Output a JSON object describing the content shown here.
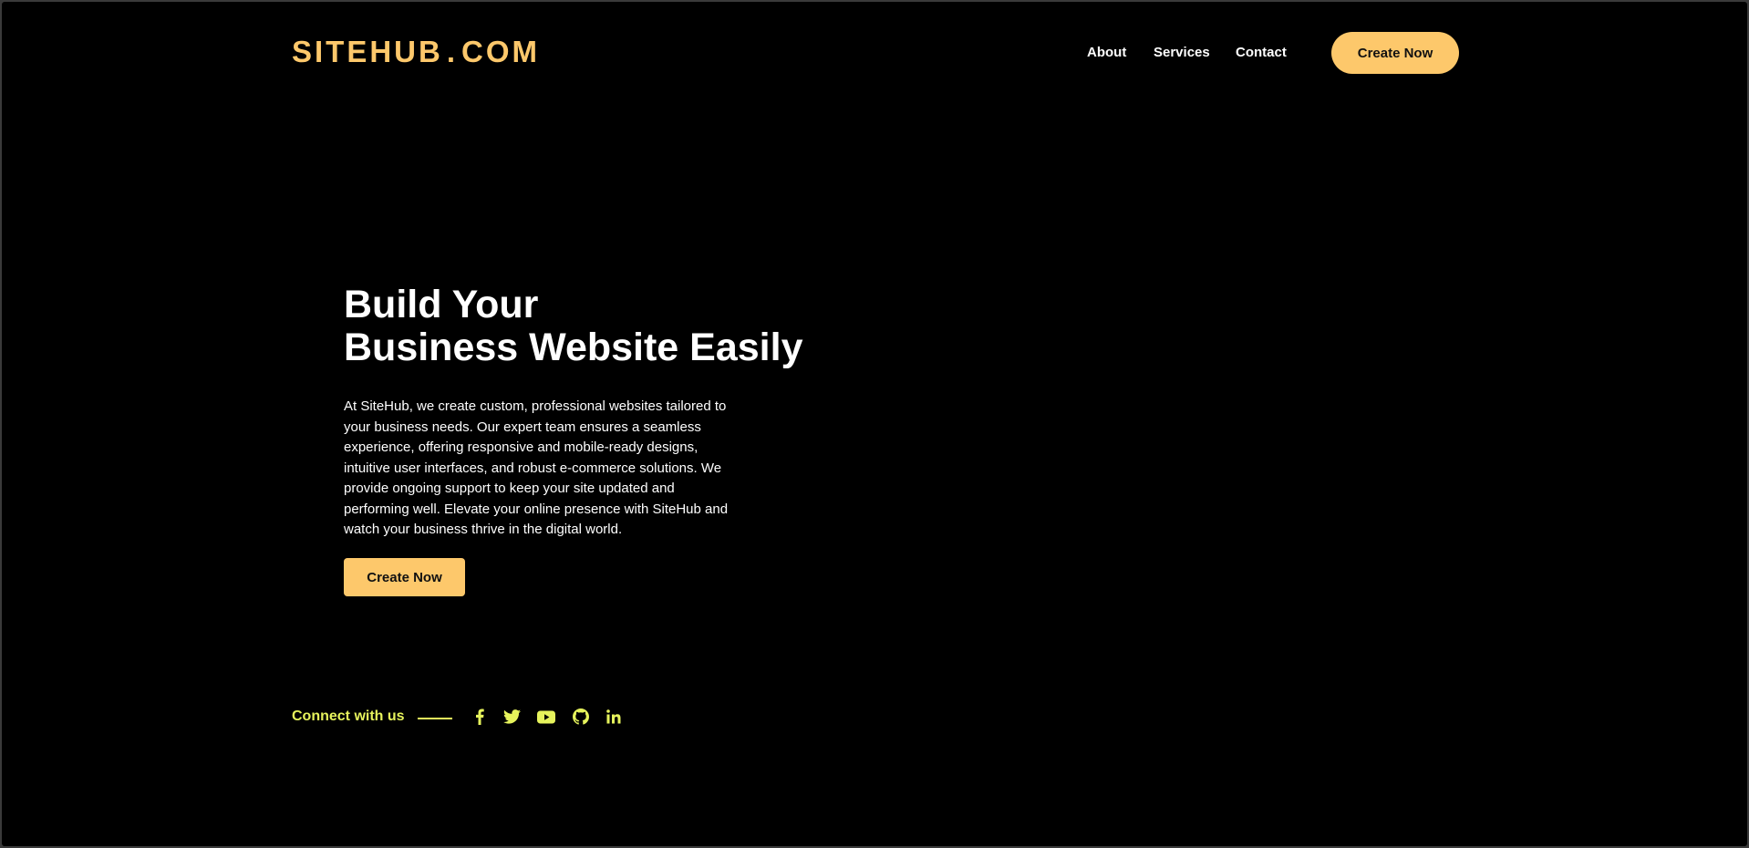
{
  "header": {
    "logo_main": "SITEHUB",
    "logo_dot": ".",
    "logo_tld": "COM",
    "nav": [
      {
        "label": "About"
      },
      {
        "label": "Services"
      },
      {
        "label": "Contact"
      }
    ],
    "cta_label": "Create Now"
  },
  "hero": {
    "title_line1": "Build Your",
    "title_line2": "Business Website Easily",
    "description": "At SiteHub, we create custom, professional websites tailored to your business needs. Our expert team ensures a seamless experience, offering responsive and mobile-ready designs, intuitive user interfaces, and robust e-commerce solutions. We provide ongoing support to keep your site updated and performing well. Elevate your online presence with SiteHub and watch your business thrive in the digital world.",
    "cta_label": "Create Now"
  },
  "social": {
    "label": "Connect with us",
    "icons": [
      "facebook-icon",
      "twitter-icon",
      "youtube-icon",
      "github-icon",
      "linkedin-icon"
    ]
  },
  "colors": {
    "background": "#000000",
    "accent": "#fdc86b",
    "social_accent": "#e6f35c",
    "text": "#ffffff"
  }
}
